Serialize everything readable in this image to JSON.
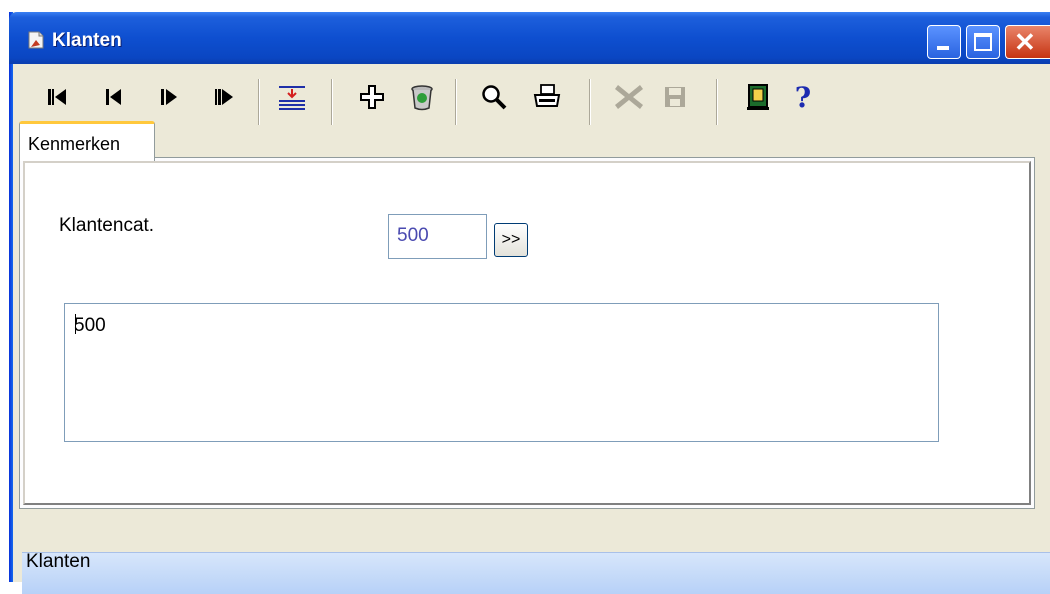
{
  "window": {
    "title": "Klanten",
    "controls": [
      "minimize",
      "maximize",
      "close"
    ]
  },
  "toolbar": {
    "buttons": [
      {
        "icon": "first-record-icon"
      },
      {
        "icon": "previous-record-icon"
      },
      {
        "icon": "next-record-icon"
      },
      {
        "icon": "last-record-icon"
      },
      {
        "icon": "import-icon"
      },
      {
        "icon": "add-icon"
      },
      {
        "icon": "delete-icon"
      },
      {
        "icon": "search-icon"
      },
      {
        "icon": "print-icon"
      },
      {
        "icon": "cancel-icon"
      },
      {
        "icon": "save-icon"
      },
      {
        "icon": "exit-door-icon"
      },
      {
        "icon": "help-icon",
        "glyph": "?"
      }
    ]
  },
  "tabs": [
    {
      "label": "Kenmerken",
      "active": true
    }
  ],
  "form": {
    "category_label": "Klantencat.",
    "category_value": "500",
    "lookup_button_label": ">>",
    "memo_value": "500"
  },
  "statusbar": {
    "text": "Klanten"
  },
  "colors": {
    "titlebar": "#0A46C2",
    "face": "#ECE9D8",
    "tab_accent": "#FFC83C",
    "input_border": "#7F9DB9",
    "input_text": "#4A4AB0",
    "statusbar": "#C5DAF8"
  }
}
